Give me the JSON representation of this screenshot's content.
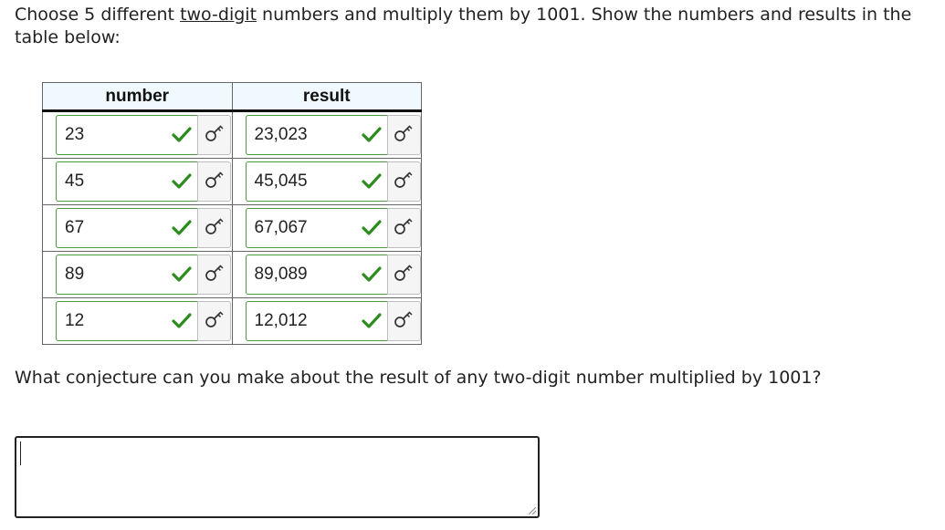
{
  "prompt": {
    "before": "Choose 5 different ",
    "underlined": "two-digit",
    "after": " numbers and multiply them by 1001. Show the numbers and results in the table below:"
  },
  "table": {
    "headers": [
      "number",
      "result"
    ],
    "rows": [
      {
        "number": "23",
        "result": "23,023"
      },
      {
        "number": "45",
        "result": "45,045"
      },
      {
        "number": "67",
        "result": "67,067"
      },
      {
        "number": "89",
        "result": "89,089"
      },
      {
        "number": "12",
        "result": "12,012"
      }
    ]
  },
  "question": "What conjecture can you make about the result of any two-digit number multiplied by 1001?",
  "answer_box": {
    "value": ""
  },
  "icons": {
    "correct": "check-icon",
    "key": "key-icon"
  },
  "colors": {
    "correct": "#2e8b1f",
    "field_border": "#4c9a3c",
    "header_bg": "#f0f9fe"
  }
}
